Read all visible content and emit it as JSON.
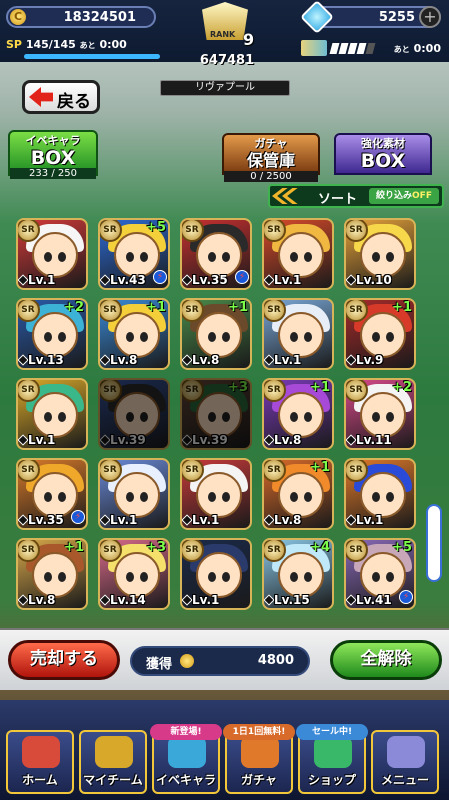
{
  "header": {
    "coins": "18324501",
    "gems": "5255",
    "sp_label": "SP",
    "sp_value": "145/145",
    "sp_suffix": "あと",
    "sp_time": "0:00",
    "rank_label": "RANK",
    "rank": "9",
    "rank_points": "647481",
    "stamina_suffix": "あと",
    "stamina_time": "0:00",
    "stamina_bars_on": 4,
    "stamina_bars_total": 5,
    "team_name": "リヴァプール"
  },
  "back_button": {
    "label": "戻る"
  },
  "tabs": [
    {
      "top": "イベキャラ",
      "main": "BOX",
      "count": "233 / 250",
      "active": true
    },
    {
      "top": "ガチャ",
      "main": "保管庫",
      "count": "0 / 2500",
      "active": false
    },
    {
      "top": "強化素材",
      "main": "BOX",
      "count": "",
      "active": false
    }
  ],
  "sort": {
    "label": "ソート",
    "filter_label": "絞り込み",
    "filter_state": "OFF"
  },
  "cards": [
    {
      "rarity": "SR",
      "level": "Lv.1",
      "plus": "",
      "bolt": false,
      "dim": false,
      "hair": "#f6f6f6",
      "bg": "#d33a3a"
    },
    {
      "rarity": "SR",
      "level": "Lv.43",
      "plus": "+5",
      "bolt": true,
      "dim": false,
      "hair": "#f4d03a",
      "bg": "#2d6bd6"
    },
    {
      "rarity": "SR",
      "level": "Lv.35",
      "plus": "",
      "bolt": true,
      "dim": false,
      "hair": "#2a2a2a",
      "bg": "#c83030"
    },
    {
      "rarity": "SR",
      "level": "Lv.1",
      "plus": "",
      "bolt": false,
      "dim": false,
      "hair": "#f0b840",
      "bg": "#d84a2a"
    },
    {
      "rarity": "SR",
      "level": "Lv.10",
      "plus": "",
      "bolt": false,
      "dim": false,
      "hair": "#f7d84a",
      "bg": "#e7a23a"
    },
    {
      "rarity": "SR",
      "level": "Lv.13",
      "plus": "+2",
      "bolt": false,
      "dim": false,
      "hair": "#3bb2d6",
      "bg": "#2a5aa8"
    },
    {
      "rarity": "SR",
      "level": "Lv.8",
      "plus": "+1",
      "bolt": false,
      "dim": false,
      "hair": "#f4cf3a",
      "bg": "#3a8ad8"
    },
    {
      "rarity": "SR",
      "level": "Lv.8",
      "plus": "+1",
      "bolt": false,
      "dim": false,
      "hair": "#6a4a2a",
      "bg": "#4a8a4a"
    },
    {
      "rarity": "SR",
      "level": "Lv.1",
      "plus": "",
      "bolt": false,
      "dim": false,
      "hair": "#e8eef8",
      "bg": "#7aa8d8"
    },
    {
      "rarity": "SR",
      "level": "Lv.9",
      "plus": "+1",
      "bolt": false,
      "dim": false,
      "hair": "#d83a2a",
      "bg": "#a82a2a"
    },
    {
      "rarity": "SR",
      "level": "Lv.1",
      "plus": "",
      "bolt": false,
      "dim": false,
      "hair": "#3ab88a",
      "bg": "#d8a82a"
    },
    {
      "rarity": "SR",
      "level": "Lv.39",
      "plus": "",
      "bolt": false,
      "dim": true,
      "hair": "#2a2a2a",
      "bg": "#3a5aa8"
    },
    {
      "rarity": "SR",
      "level": "Lv.39",
      "plus": "+3",
      "bolt": false,
      "dim": true,
      "hair": "#2a6a3a",
      "bg": "#6a4a3a"
    },
    {
      "rarity": "SR",
      "level": "Lv.8",
      "plus": "+1",
      "bolt": false,
      "dim": false,
      "hair": "#a84ad8",
      "bg": "#7a3ab8"
    },
    {
      "rarity": "SR",
      "level": "Lv.11",
      "plus": "+2",
      "bolt": false,
      "dim": false,
      "hair": "#f4f4f4",
      "bg": "#d84a8a"
    },
    {
      "rarity": "SR",
      "level": "Lv.35",
      "plus": "",
      "bolt": true,
      "dim": false,
      "hair": "#f0a82a",
      "bg": "#d87a2a"
    },
    {
      "rarity": "SR",
      "level": "Lv.1",
      "plus": "",
      "bolt": false,
      "dim": false,
      "hair": "#e8f0ff",
      "bg": "#6a8ad8"
    },
    {
      "rarity": "SR",
      "level": "Lv.1",
      "plus": "",
      "bolt": false,
      "dim": false,
      "hair": "#f4f4f4",
      "bg": "#c83a3a"
    },
    {
      "rarity": "SR",
      "level": "Lv.8",
      "plus": "+1",
      "bolt": false,
      "dim": false,
      "hair": "#f08a2a",
      "bg": "#d86a2a"
    },
    {
      "rarity": "SR",
      "level": "Lv.1",
      "plus": "",
      "bolt": false,
      "dim": false,
      "hair": "#2a4ad8",
      "bg": "#e07a2a"
    },
    {
      "rarity": "SR",
      "level": "Lv.8",
      "plus": "+1",
      "bolt": false,
      "dim": false,
      "hair": "#a8582a",
      "bg": "#d8a84a"
    },
    {
      "rarity": "SR",
      "level": "Lv.14",
      "plus": "+3",
      "bolt": false,
      "dim": false,
      "hair": "#f4e06a",
      "bg": "#d86a8a"
    },
    {
      "rarity": "SR",
      "level": "Lv.1",
      "plus": "",
      "bolt": false,
      "dim": false,
      "hair": "#2a3a6a",
      "bg": "#1a2a4a"
    },
    {
      "rarity": "SR",
      "level": "Lv.15",
      "plus": "+4",
      "bolt": false,
      "dim": false,
      "hair": "#bfe8f8",
      "bg": "#8ac8e8"
    },
    {
      "rarity": "SR",
      "level": "Lv.41",
      "plus": "+5",
      "bolt": true,
      "dim": false,
      "hair": "#c8a8b8",
      "bg": "#8a6ab8"
    }
  ],
  "bottom": {
    "sell_label": "売却する",
    "gain_label": "獲得",
    "gain_value": "4800",
    "clear_label": "全解除"
  },
  "nav": {
    "items": [
      {
        "label": "ホーム",
        "tag": ""
      },
      {
        "label": "マイチーム",
        "tag": ""
      },
      {
        "label": "イベキャラ",
        "tag": "新登場!"
      },
      {
        "label": "ガチャ",
        "tag": "1日1回無料!"
      },
      {
        "label": "ショップ",
        "tag": "セール中!"
      },
      {
        "label": "メニュー",
        "tag": ""
      }
    ]
  },
  "colors": {
    "accent_green": "#3aa343",
    "sell_red": "#d6281a",
    "gold_border": "#d8b458"
  }
}
